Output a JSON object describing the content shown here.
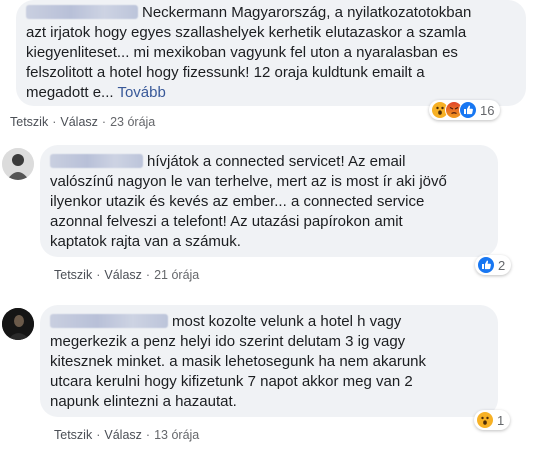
{
  "comments": [
    {
      "lines": [
        "Neckermann Magyarország, a nyilatkozatotokban",
        "azt irjatok hogy egyes szallashelyek kerhetik elutazaskor a szamla",
        "kiegyenliteset... mi mexikoban vagyunk fel uton a nyaralasban es",
        "felszolitott a hotel hogy fizessunk! 12 oraja kuldtunk emailt a",
        "megadott e..."
      ],
      "more_label": "Tovább",
      "like_label": "Tetszik",
      "reply_label": "Válasz",
      "time": "23 órája",
      "reactions": [
        "wow",
        "angry",
        "like"
      ],
      "reaction_count": "16"
    },
    {
      "lines": [
        "hívjátok a connected servicet! Az email",
        "valószínű nagyon le van terhelve, mert az is most ír aki jövő",
        "ilyenkor utazik és kevés az ember... a connected service",
        "azonnal felveszi a telefont! Az utazási papírokon amit",
        "kaptatok rajta van a számuk."
      ],
      "like_label": "Tetszik",
      "reply_label": "Válasz",
      "time": "21 órája",
      "reactions": [
        "like"
      ],
      "reaction_count": "2"
    },
    {
      "lines": [
        "most kozolte velunk a hotel h vagy",
        "megerkezik a penz helyi ido szerint delutam 3 ig vagy",
        "kitesznek minket. a masik lehetosegunk ha nem akarunk",
        "utcara kerulni hogy kifizetunk 7 napot akkor meg van 2",
        "napunk elintezni a hazautat."
      ],
      "like_label": "Tetszik",
      "reply_label": "Válasz",
      "time": "13 órája",
      "reactions": [
        "wow"
      ],
      "reaction_count": "1"
    }
  ],
  "separator": "·",
  "colors": {
    "like": "#1877f2",
    "wow": "#f7b125",
    "angry": "#e9710f",
    "link": "#385898"
  }
}
